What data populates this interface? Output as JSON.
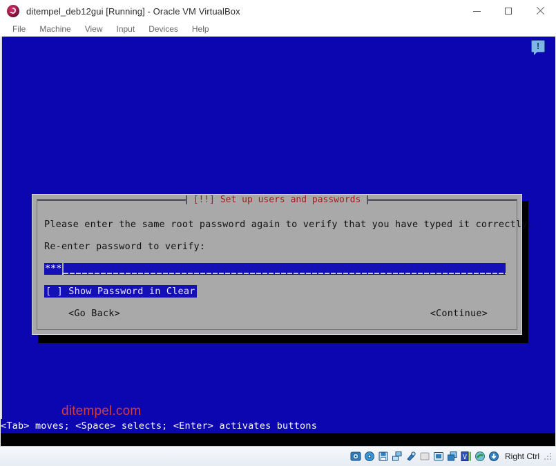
{
  "window": {
    "title": "ditempel_deb12gui [Running] - Oracle VM VirtualBox",
    "app_icon": "virtualbox-icon",
    "controls": {
      "minimize": "minimize-button",
      "maximize": "maximize-button",
      "close": "close-button"
    }
  },
  "menubar": {
    "items": [
      {
        "label": "File"
      },
      {
        "label": "Machine"
      },
      {
        "label": "View"
      },
      {
        "label": "Input"
      },
      {
        "label": "Devices"
      },
      {
        "label": "Help"
      }
    ]
  },
  "console": {
    "background_color": "#0b06b0",
    "watermark": "ditempel.com",
    "watermark_color": "#d43b3b",
    "notification_icon": "info-exclamation-icon",
    "hint_bar": "<Tab> moves; <Space> selects; <Enter> activates buttons"
  },
  "dialog": {
    "title": "[!!] Set up users and passwords",
    "title_color": "#9b1c1c",
    "background_color": "#a9a9a9",
    "line1": "Please enter the same root password again to verify that you have typed it correctly.",
    "line2": "Re-enter password to verify:",
    "password_field": {
      "value": "***",
      "masked": true,
      "highlight_color": "#1410b5"
    },
    "checkbox": {
      "label": "[ ] Show Password in Clear",
      "checked": false,
      "focused": true
    },
    "buttons": [
      {
        "label": "<Go Back>"
      },
      {
        "label": "<Continue>"
      }
    ]
  },
  "statusbar": {
    "host_key_label": "Right Ctrl",
    "icons": [
      {
        "name": "hard-disk-icon"
      },
      {
        "name": "optical-disk-icon"
      },
      {
        "name": "floppy-disk-icon"
      },
      {
        "name": "network-icon"
      },
      {
        "name": "usb-icon"
      },
      {
        "name": "shared-folders-icon"
      },
      {
        "name": "display-icon"
      },
      {
        "name": "recording-icon"
      },
      {
        "name": "virtualization-icon"
      },
      {
        "name": "mouse-integration-icon"
      },
      {
        "name": "keyboard-capture-icon"
      }
    ]
  }
}
